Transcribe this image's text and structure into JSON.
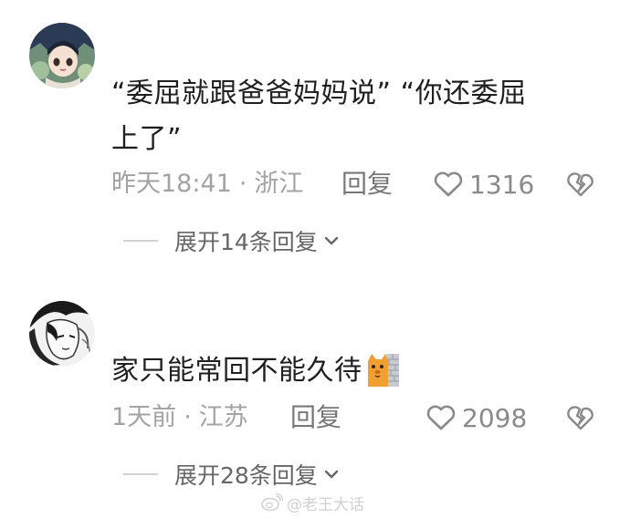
{
  "comments": [
    {
      "avatar_icon": "anime-avatar-icon",
      "text_line1": "“委屈就跟爸爸妈妈说” “你还委屈",
      "text_line2": "上了”",
      "time": "昨天18:41",
      "dot": "·",
      "location": "浙江",
      "reply_label": "回复",
      "likes": "1316",
      "expand_label": "展开14条回复"
    },
    {
      "avatar_icon": "manga-avatar-icon",
      "text": "家只能常回不能久待",
      "emoji_icon": "cat-behind-wall-emoji-icon",
      "time": "1天前",
      "dot": "·",
      "location": "江苏",
      "reply_label": "回复",
      "likes": "2098",
      "expand_label": "展开28条回复"
    }
  ],
  "watermark": {
    "icon": "weibo-logo-icon",
    "text": "@老王大话"
  },
  "colors": {
    "text": "#1f1f1f",
    "meta": "#a3a3a3",
    "like": "#8a8a8a",
    "expand": "#666666"
  }
}
